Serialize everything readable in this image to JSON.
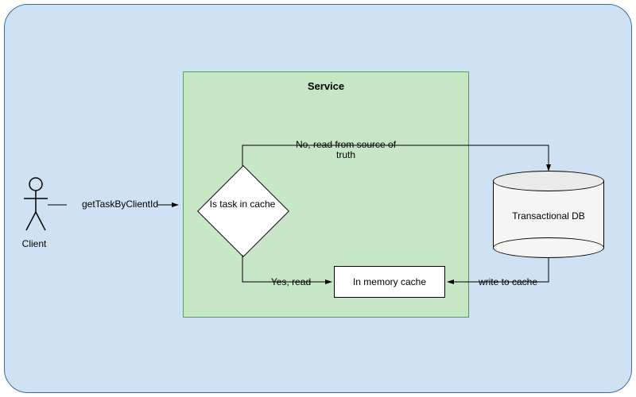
{
  "actor": {
    "label": "Client"
  },
  "service": {
    "title": "Service"
  },
  "decision": {
    "label": "Is task in cache"
  },
  "cache": {
    "label": "In memory cache"
  },
  "database": {
    "label": "Transactional DB"
  },
  "edges": {
    "client_to_service": "getTaskByClientId",
    "decision_no": "No, read from source of truth",
    "decision_yes": "Yes, read",
    "db_to_cache": "write to cache"
  },
  "colors": {
    "panel_bg": "#cfe2f3",
    "panel_border": "#3b6fa3",
    "service_bg": "#c6e6c6",
    "service_border": "#5b9b5b",
    "node_bg": "#ffffff",
    "db_bg": "#f5f5f5"
  }
}
